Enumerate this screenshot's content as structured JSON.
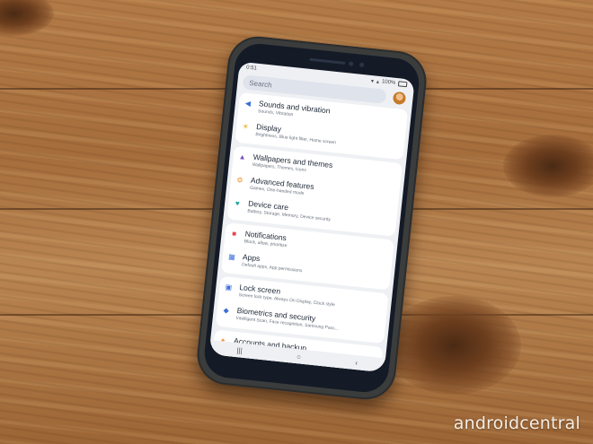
{
  "status_bar": {
    "time": "0:51",
    "battery": "100%"
  },
  "search": {
    "placeholder": "Search"
  },
  "groups": [
    {
      "items": [
        {
          "icon": "speaker-icon",
          "color": "#3b6fd8",
          "title": "Sounds and vibration",
          "subtitle": "Sounds, Vibration"
        },
        {
          "icon": "brightness-icon",
          "color": "#e5b000",
          "title": "Display",
          "subtitle": "Brightness, Blue light filter, Home screen"
        }
      ]
    },
    {
      "items": [
        {
          "icon": "palette-icon",
          "color": "#7c4dbf",
          "title": "Wallpapers and themes",
          "subtitle": "Wallpapers, Themes, Icons"
        },
        {
          "icon": "gear-icon",
          "color": "#f0952e",
          "title": "Advanced features",
          "subtitle": "Games, One-handed mode"
        },
        {
          "icon": "device-care-icon",
          "color": "#1aa39a",
          "title": "Device care",
          "subtitle": "Battery, Storage, Memory, Device security"
        }
      ]
    },
    {
      "items": [
        {
          "icon": "notification-icon",
          "color": "#e4464f",
          "title": "Notifications",
          "subtitle": "Block, allow, prioritize"
        },
        {
          "icon": "apps-icon",
          "color": "#3b6fd8",
          "title": "Apps",
          "subtitle": "Default apps, App permissions"
        }
      ]
    },
    {
      "items": [
        {
          "icon": "lock-icon",
          "color": "#3b6fd8",
          "title": "Lock screen",
          "subtitle": "Screen lock type, Always On Display, Clock style"
        },
        {
          "icon": "shield-icon",
          "color": "#3b6fd8",
          "title": "Biometrics and security",
          "subtitle": "Intelligent Scan, Face recognition, Samsung Pass..."
        }
      ]
    },
    {
      "items": [
        {
          "icon": "key-icon",
          "color": "#f0952e",
          "title": "Accounts and backup",
          "subtitle": ""
        }
      ]
    }
  ],
  "nav": {
    "recents": "|||",
    "home": "○",
    "back": "‹"
  },
  "watermark": "androidcentral"
}
